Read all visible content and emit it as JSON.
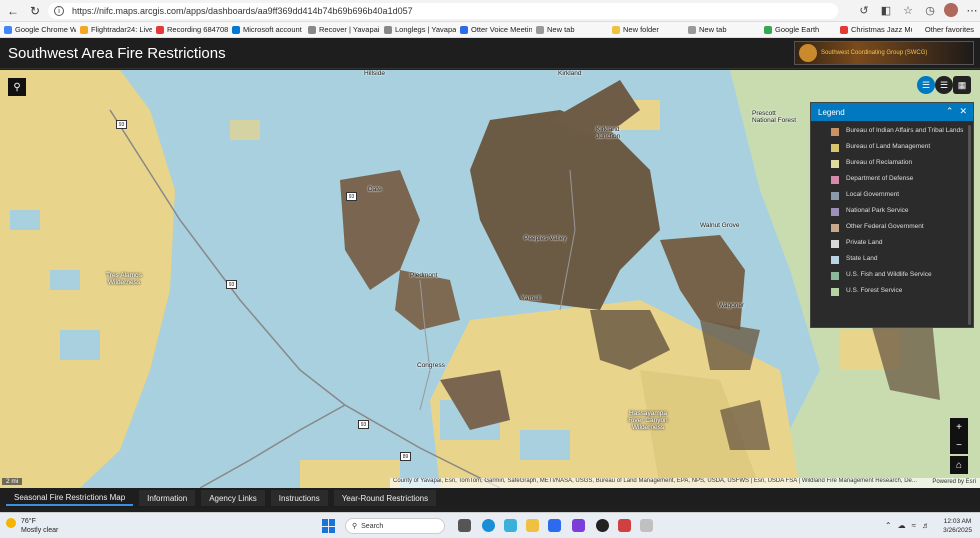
{
  "browser": {
    "url": "https://nifc.maps.arcgis.com/apps/dashboards/aa9ff369dd414b74b69b696b40a1d057",
    "bookmarks": [
      {
        "label": "Google Chrome We...",
        "color": "#4285f4"
      },
      {
        "label": "Flightradar24: Live F...",
        "color": "#f5a623"
      },
      {
        "label": "Recording 6847083...",
        "color": "#e53935"
      },
      {
        "label": "Microsoft account |...",
        "color": "#0078d4"
      },
      {
        "label": "Recover | Yavapai Li...",
        "color": "#888888"
      },
      {
        "label": "Longlegs | Yavapai L...",
        "color": "#888888"
      },
      {
        "label": "Otter Voice Meeting...",
        "color": "#2c6bed"
      },
      {
        "label": "New tab",
        "color": "#999999"
      },
      {
        "label": "New folder",
        "color": "#f0c040"
      },
      {
        "label": "New tab",
        "color": "#999999"
      },
      {
        "label": "Google Earth",
        "color": "#34a853"
      },
      {
        "label": "Christmas Jazz Musi...",
        "color": "#e53935"
      }
    ],
    "other_favorites": "Other favorites"
  },
  "app": {
    "title": "Southwest Area Fire Restrictions",
    "logo_text": "Southwest Coordinating Group (SWCG)"
  },
  "map": {
    "places": [
      {
        "name": "Hillside"
      },
      {
        "name": "Kirkland"
      },
      {
        "name": "Kirkland Junction"
      },
      {
        "name": "Prescott National Forest"
      },
      {
        "name": "Date"
      },
      {
        "name": "Peeples Valley"
      },
      {
        "name": "Walnut Grove"
      },
      {
        "name": "Tres Alamos Wilderness"
      },
      {
        "name": "Piedmont"
      },
      {
        "name": "Yarnell"
      },
      {
        "name": "Wagoner"
      },
      {
        "name": "Congress"
      },
      {
        "name": "Hassayampa River Canyon Wilderness"
      }
    ],
    "shields": [
      "93",
      "93",
      "93",
      "89",
      "93"
    ],
    "scale": "2 mi",
    "attribution": "County of Yavapai, Esri, TomTom, Garmin, SafeGraph, METI/NASA, USGS, Bureau of Land Management, EPA, NPS, USDA, USFWS | Esri, USDA FSA | Wildland Fire Management Research, De...",
    "powered_by": "Powered by Esri"
  },
  "legend": {
    "title": "Legend",
    "items": [
      {
        "label": "Bureau of Indian Affairs and Tribal Lands",
        "color": "#c89264"
      },
      {
        "label": "Bureau of Land Management",
        "color": "#d8c46a"
      },
      {
        "label": "Bureau of Reclamation",
        "color": "#e0dca0"
      },
      {
        "label": "Department of Defense",
        "color": "#d48aa8"
      },
      {
        "label": "Local Government",
        "color": "#8a9aa8"
      },
      {
        "label": "National Park Service",
        "color": "#9a90b8"
      },
      {
        "label": "Other Federal Government",
        "color": "#c8a888"
      },
      {
        "label": "Private Land",
        "color": "#d8d8d8"
      },
      {
        "label": "State Land",
        "color": "#b8d4e4"
      },
      {
        "label": "U.S. Fish and Wildlife Service",
        "color": "#8ab89a"
      },
      {
        "label": "U.S. Forest Service",
        "color": "#b4d4a4"
      }
    ]
  },
  "tabs": [
    {
      "label": "Seasonal Fire Restrictions Map",
      "active": true
    },
    {
      "label": "Information",
      "active": false
    },
    {
      "label": "Agency Links",
      "active": false
    },
    {
      "label": "Instructions",
      "active": false
    },
    {
      "label": "Year-Round Restrictions",
      "active": false
    }
  ],
  "taskbar": {
    "temperature": "76°F",
    "weather": "Mostly clear",
    "search_placeholder": "Search",
    "time": "12:03 AM",
    "date": "3/26/2025"
  },
  "colors": {
    "blm_yellow": "#e8d48a",
    "state_blue": "#a8d0de",
    "private_land": "#6b5a44",
    "forest_green": "#c8dcb0",
    "accent": "#0079c1"
  }
}
